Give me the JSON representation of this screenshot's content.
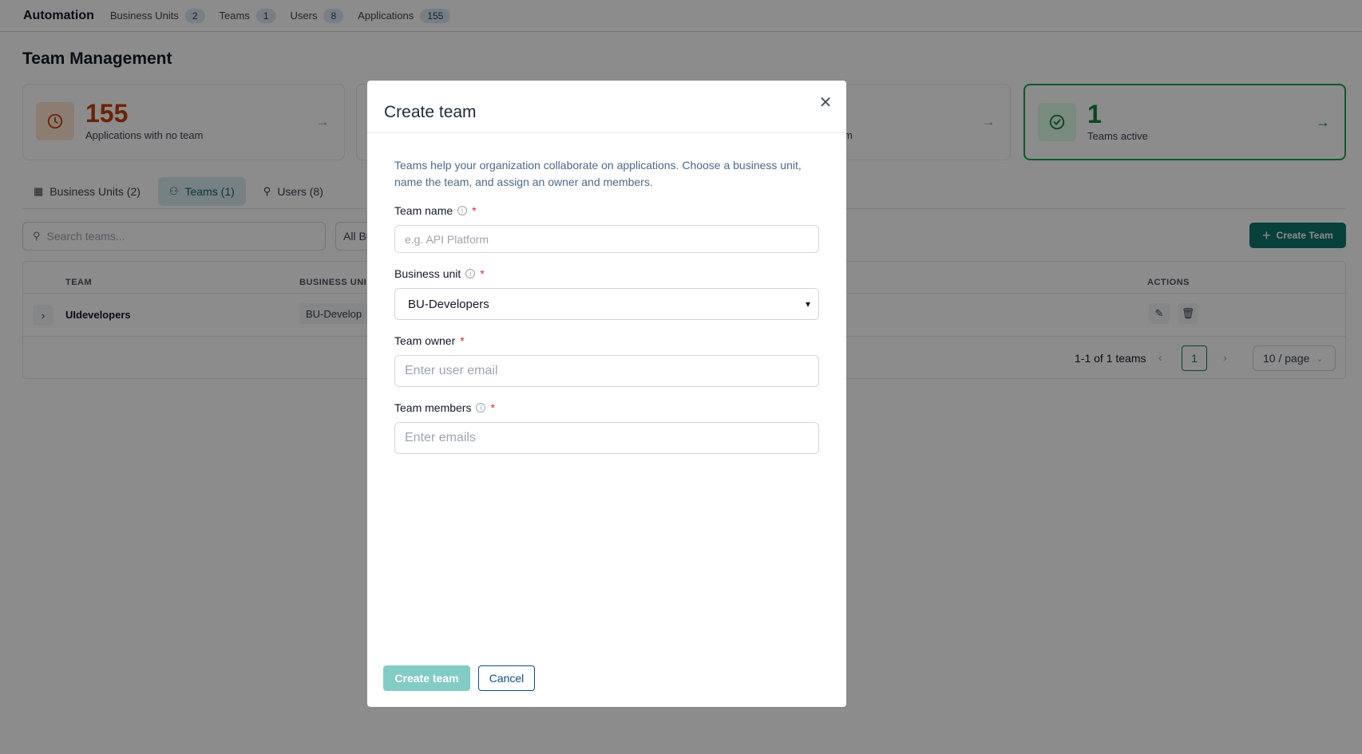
{
  "topnav": {
    "brand": "Automation",
    "items": [
      {
        "label": "Business Units",
        "count": "2"
      },
      {
        "label": "Teams",
        "count": "1"
      },
      {
        "label": "Users",
        "count": "8"
      },
      {
        "label": "Applications",
        "count": "155"
      }
    ]
  },
  "page": {
    "title": "Team Management"
  },
  "cards": [
    {
      "value": "155",
      "label": "Applications with no team"
    },
    {
      "label_fragment": "m"
    },
    {
      "value": "1",
      "label": "Teams active"
    }
  ],
  "tabs": [
    {
      "label": "Business Units (2)"
    },
    {
      "label": "Teams (1)"
    },
    {
      "label": "Users (8)"
    }
  ],
  "filters": {
    "search_placeholder": "Search teams...",
    "business_unit_filter": "All Bu",
    "create_button": "Create Team"
  },
  "table": {
    "headers": {
      "team": "TEAM",
      "business_unit": "BUSINESS UNI",
      "actions": "ACTIONS"
    },
    "rows": [
      {
        "team": "UIdevelopers",
        "business_unit": "BU-Develop"
      }
    ],
    "pagination": {
      "summary": "1-1 of 1 teams",
      "current_page": "1",
      "page_size": "10 / page"
    }
  },
  "modal": {
    "title": "Create team",
    "description": "Teams help your organization collaborate on applications. Choose a business unit, name the team, and assign an owner and members.",
    "team_name": {
      "label": "Team name",
      "placeholder": "e.g. API Platform",
      "required": "*"
    },
    "business_unit": {
      "label": "Business unit",
      "value": "BU-Developers",
      "required": "*"
    },
    "team_owner": {
      "label": "Team owner",
      "placeholder": "Enter user email",
      "required": "*"
    },
    "team_members": {
      "label": "Team members",
      "placeholder": "Enter emails",
      "required": "*"
    },
    "create_button": "Create team",
    "cancel_button": "Cancel"
  },
  "colors": {
    "accent": "#0f766e",
    "orange": "#c2410c",
    "green": "#15803d",
    "disabled_primary": "#82ccc6"
  }
}
